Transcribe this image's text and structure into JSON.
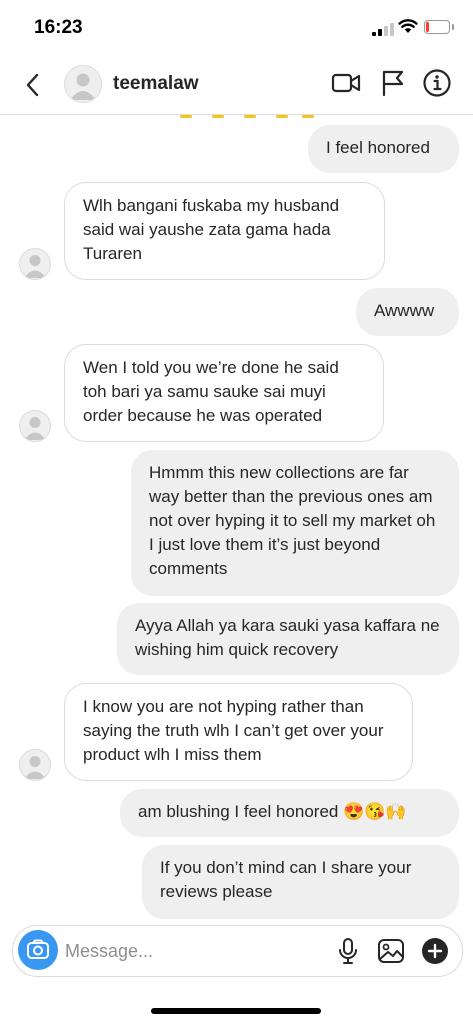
{
  "status_bar": {
    "time": "16:23",
    "battery_level": 0.15
  },
  "header": {
    "username": "teemalaw",
    "icons": [
      "back-icon",
      "avatar",
      "video-camera-icon",
      "flag-icon",
      "info-icon"
    ]
  },
  "messages": [
    {
      "direction": "outgoing",
      "text": "I feel honored"
    },
    {
      "direction": "incoming",
      "text": "Wlh bangani fuskaba my husband said wai yaushe zata gama hada Turaren"
    },
    {
      "direction": "outgoing",
      "text": "Awwww"
    },
    {
      "direction": "incoming",
      "text": "Wen I told you we’re done he said toh bari ya samu sauke sai muyi order because he was operated"
    },
    {
      "direction": "outgoing",
      "text": "Hmmm this new collections are far way better than the previous ones am not over hyping it to sell my market oh I just love them it’s just beyond comments"
    },
    {
      "direction": "outgoing",
      "text": "Ayya Allah ya kara sauki yasa kaffara ne wishing him quick recovery"
    },
    {
      "direction": "incoming",
      "text": "I know you are not hyping rather than saying the truth wlh I can’t get over your product wlh I miss them"
    },
    {
      "direction": "outgoing",
      "text": "am blushing I feel honored 😍😘🙌"
    },
    {
      "direction": "outgoing",
      "text": "If you don’t mind can I share your reviews please"
    }
  ],
  "composer": {
    "placeholder": "Message...",
    "icons": [
      "camera-icon",
      "microphone-icon",
      "gallery-icon",
      "plus-icon"
    ]
  },
  "colors": {
    "camera_button": "#3897f0",
    "outgoing_bubble": "#efefef",
    "incoming_border": "#dbdbdb",
    "placeholder_text": "#8e8e8e",
    "battery_low": "#ff3b30"
  }
}
